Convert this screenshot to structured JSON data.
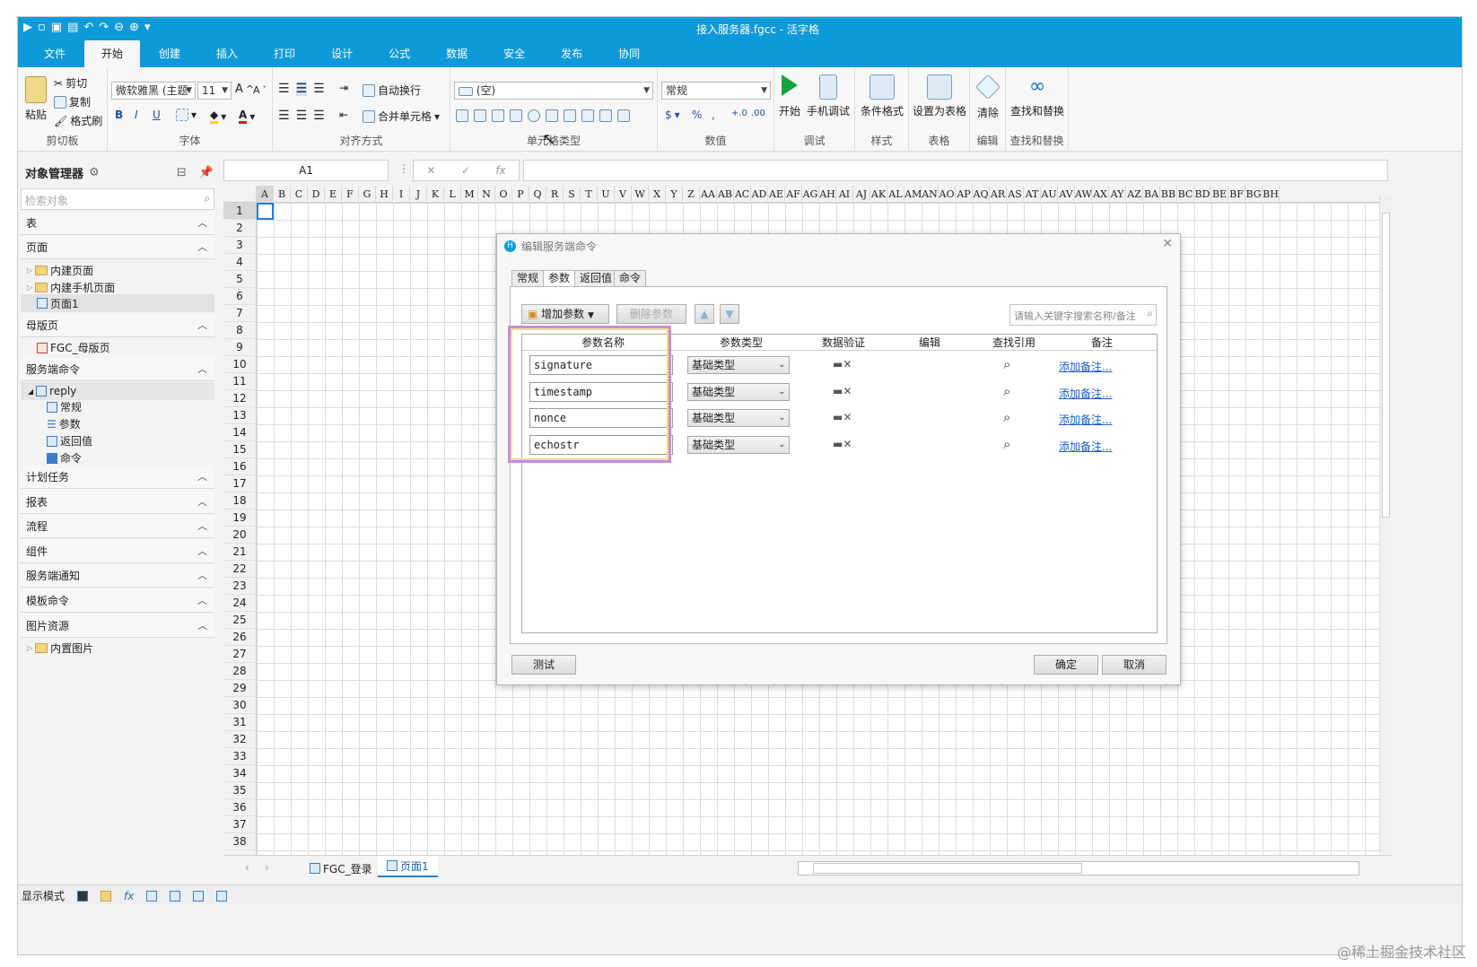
{
  "window": {
    "title": "接入服务器.fgcc - 活字格"
  },
  "menu": {
    "tabs": [
      "文件",
      "开始",
      "创建",
      "插入",
      "打印",
      "设计",
      "公式",
      "数据",
      "安全",
      "发布",
      "协同"
    ],
    "active": "开始"
  },
  "ribbon": {
    "clipboard": {
      "paste": "粘贴",
      "cut": "剪切",
      "copy": "复制",
      "format_painter": "格式刷",
      "label": "剪切板"
    },
    "font": {
      "family": "微软雅黑 (主题",
      "size": "11",
      "label": "字体",
      "bold": "B",
      "italic": "I",
      "underline": "U",
      "grow": "A",
      "shrink": "A"
    },
    "align": {
      "auto_wrap": "自动换行",
      "merge": "合并单元格",
      "label": "对齐方式"
    },
    "celltype": {
      "value": "(空)",
      "label": "单元格类型"
    },
    "number": {
      "format": "常规",
      "currency": "$",
      "percent": "%",
      "comma": ",",
      "label": "数值"
    },
    "debug": {
      "start": "开始",
      "mobile": "手机调试",
      "label": "调试"
    },
    "style": {
      "cond": "条件格式",
      "label": "样式"
    },
    "table": {
      "set": "设置为表格",
      "label": "表格"
    },
    "edit": {
      "clear": "清除",
      "label": "编辑"
    },
    "find": {
      "find_replace": "查找和替换",
      "label": "查找和替换"
    }
  },
  "formula": {
    "cell_ref": "A1",
    "fx": "fx"
  },
  "objmgr": {
    "title": "对象管理器",
    "search_placeholder": "检索对象",
    "sections": {
      "table": "表",
      "page": "页面",
      "master": "母版页",
      "servercmd": "服务端命令",
      "plan": "计划任务",
      "report": "报表",
      "flow": "流程",
      "component": "组件",
      "notify": "服务端通知",
      "template": "模板命令",
      "image": "图片资源"
    },
    "items": {
      "builtin_page": "内建页面",
      "builtin_mobile": "内建手机页面",
      "page1": "页面1",
      "master_page": "FGC_母版页",
      "reply": "reply",
      "general": "常规",
      "params": "参数",
      "retval": "返回值",
      "command": "命令",
      "builtin_image": "内置图片"
    }
  },
  "grid": {
    "columns": [
      "A",
      "B",
      "C",
      "D",
      "E",
      "F",
      "G",
      "H",
      "I",
      "J",
      "K",
      "L",
      "M",
      "N",
      "O",
      "P",
      "Q",
      "R",
      "S",
      "T",
      "U",
      "V",
      "W",
      "X",
      "Y",
      "Z",
      "AA",
      "AB",
      "AC",
      "AD",
      "AE",
      "AF",
      "AG",
      "AH",
      "AI",
      "AJ",
      "AK",
      "AL",
      "AM",
      "AN",
      "AO",
      "AP",
      "AQ",
      "AR",
      "AS",
      "AT",
      "AU",
      "AV",
      "AW",
      "AX",
      "AY",
      "AZ",
      "BA",
      "BB",
      "BC",
      "BD",
      "BE",
      "BF",
      "BG",
      "BH"
    ],
    "rows": [
      "1",
      "2",
      "3",
      "4",
      "5",
      "6",
      "7",
      "8",
      "9",
      "10",
      "11",
      "12",
      "13",
      "14",
      "15",
      "16",
      "17",
      "18",
      "19",
      "20",
      "21",
      "22",
      "23",
      "24",
      "25",
      "26",
      "27",
      "28",
      "29",
      "30",
      "31",
      "32",
      "33",
      "34",
      "35",
      "36",
      "37",
      "38"
    ]
  },
  "dialog": {
    "title": "编辑服务端命令",
    "tabs": [
      "常规",
      "参数",
      "返回值",
      "命令"
    ],
    "active_tab": "参数",
    "add_param": "增加参数",
    "del_param": "删除参数",
    "search_placeholder": "请输入关键字搜索名称/备注",
    "headers": [
      "参数名称",
      "参数类型",
      "数据验证",
      "编辑",
      "查找引用",
      "备注"
    ],
    "params": [
      {
        "name": "signature",
        "type": "基础类型",
        "note": "添加备注..."
      },
      {
        "name": "timestamp",
        "type": "基础类型",
        "note": "添加备注..."
      },
      {
        "name": "nonce",
        "type": "基础类型",
        "note": "添加备注..."
      },
      {
        "name": "echostr",
        "type": "基础类型",
        "note": "添加备注..."
      }
    ],
    "test": "测试",
    "ok": "确定",
    "cancel": "取消"
  },
  "sheets": {
    "tabs": [
      "FGC_登录",
      "页面1"
    ],
    "active": "页面1"
  },
  "status": {
    "mode": "显示模式"
  },
  "watermark": "@稀土掘金技术社区",
  "colors": {
    "accent": "#0e9ad8",
    "highlight": "#c98be0",
    "link": "#1a5fcc"
  }
}
